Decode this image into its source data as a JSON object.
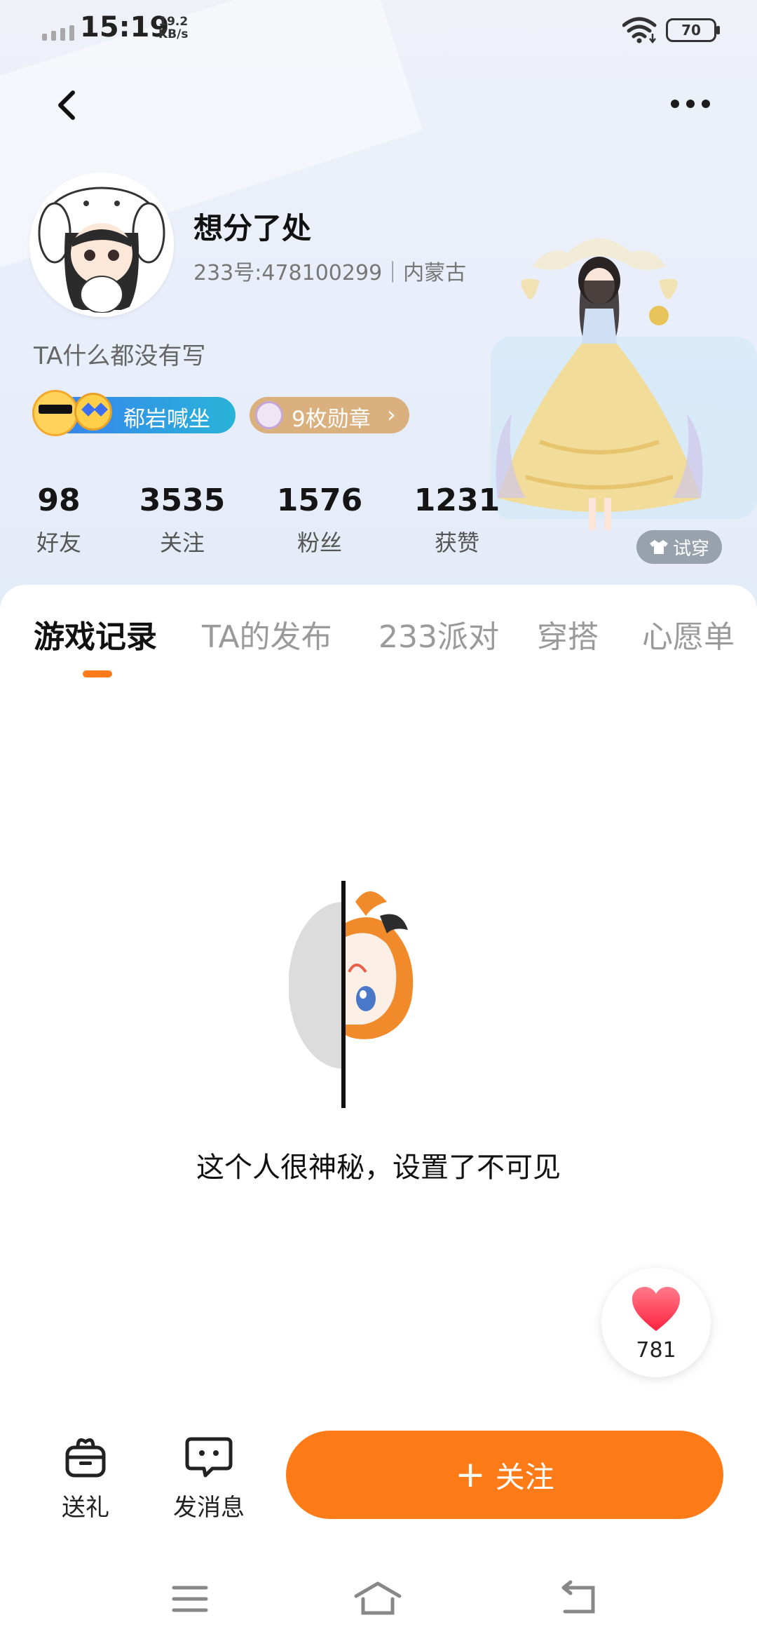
{
  "status_bar": {
    "time": "15:19",
    "net_speed_value": "19.2",
    "net_speed_unit": "KB/s",
    "battery": "70"
  },
  "profile": {
    "nickname": "想分了处",
    "id_line": "233号:478100299｜内蒙古",
    "bio": "TA什么都没有写",
    "title_badge": "郗岩喊坐",
    "medal_badge": "9枚勋章"
  },
  "stats": [
    {
      "value": "98",
      "label": "好友"
    },
    {
      "value": "3535",
      "label": "关注"
    },
    {
      "value": "1576",
      "label": "粉丝"
    },
    {
      "value": "1231",
      "label": "获赞"
    }
  ],
  "try_on": "试穿",
  "tabs": [
    {
      "label": "游戏记录",
      "active": true
    },
    {
      "label": "TA的发布",
      "active": false
    },
    {
      "label": "233派对",
      "active": false
    },
    {
      "label": "穿搭",
      "active": false
    },
    {
      "label": "心愿单",
      "active": false
    }
  ],
  "empty_state": {
    "message": "这个人很神秘，设置了不可见"
  },
  "like": {
    "count": "781"
  },
  "actions": {
    "gift": "送礼",
    "message": "发消息",
    "follow": "关注"
  },
  "colors": {
    "accent": "#ff7b17",
    "tab_indicator": "#ff7a1a",
    "badge_blue": "#3a7df0",
    "badge_gold": "#d9b07e"
  },
  "icons": [
    "back-arrow",
    "more-dots",
    "heart",
    "gift",
    "chat-bubble",
    "plus",
    "menu",
    "home",
    "back-nav"
  ]
}
